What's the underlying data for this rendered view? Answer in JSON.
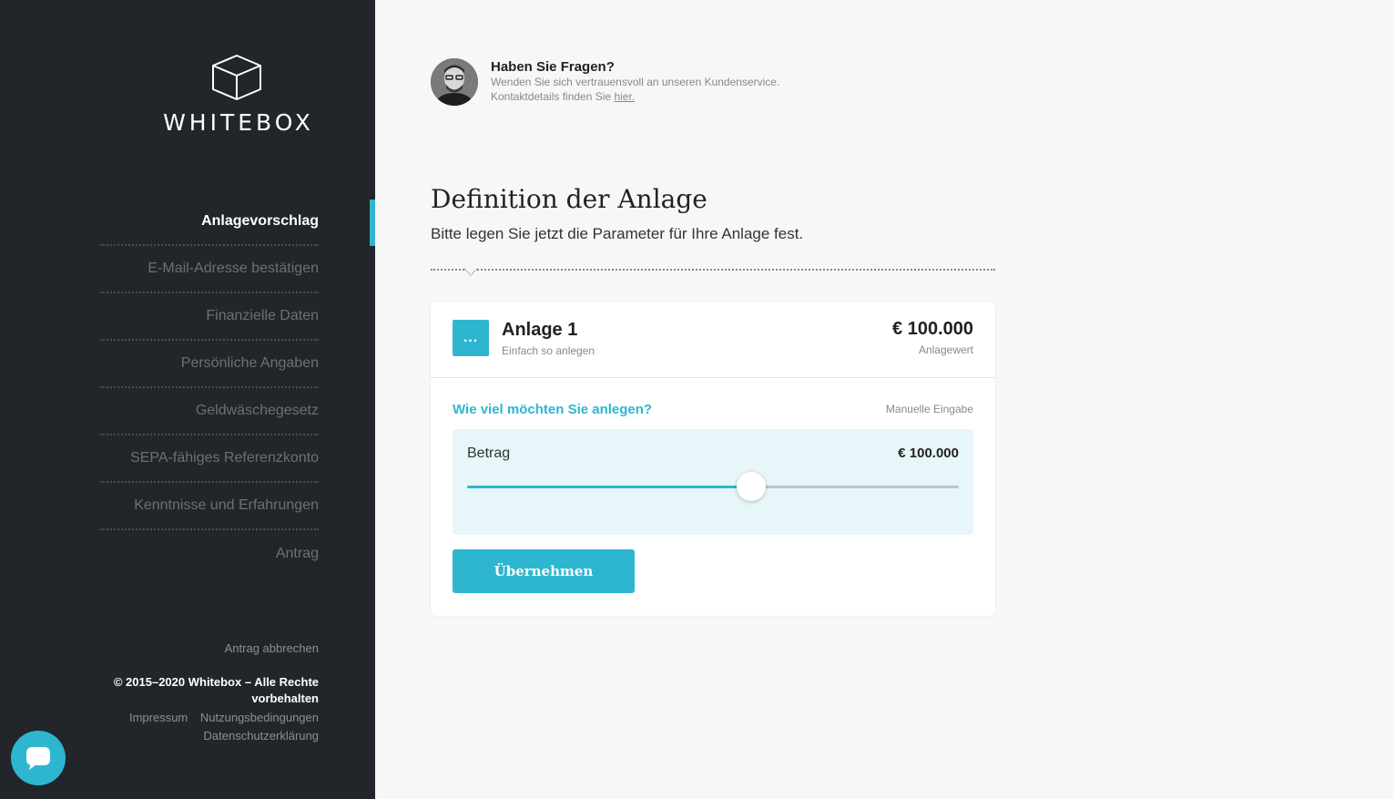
{
  "brand": {
    "name": "WHITEBOX"
  },
  "sidebar": {
    "items": [
      {
        "label": "Anlagevorschlag",
        "active": true
      },
      {
        "label": "E-Mail-Adresse bestätigen",
        "active": false
      },
      {
        "label": "Finanzielle Daten",
        "active": false
      },
      {
        "label": "Persönliche Angaben",
        "active": false
      },
      {
        "label": "Geldwäschegesetz",
        "active": false
      },
      {
        "label": "SEPA-fähiges Referenzkonto",
        "active": false
      },
      {
        "label": "Kenntnisse und Erfahrungen",
        "active": false
      },
      {
        "label": "Antrag",
        "active": false
      }
    ],
    "cancel_label": "Antrag abbrechen",
    "copyright_line1": "© 2015–2020 Whitebox – Alle Rechte",
    "copyright_line2": "vorbehalten",
    "links": {
      "impressum": "Impressum",
      "terms": "Nutzungsbedingungen",
      "privacy": "Datenschutzerklärung"
    }
  },
  "help": {
    "title": "Haben Sie Fragen?",
    "line1": "Wenden Sie sich vertrauensvoll an unseren Kundenservice.",
    "line2_prefix": "Kontaktdetails finden Sie",
    "link": "hier."
  },
  "main": {
    "title": "Definition der Anlage",
    "subtitle": "Bitte legen Sie jetzt die Parameter für Ihre Anlage fest."
  },
  "card": {
    "icon_text": "...",
    "name": "Anlage 1",
    "sub": "Einfach so anlegen",
    "amount": "€ 100.000",
    "amount_label": "Anlagewert",
    "question": "Wie viel möchten Sie anlegen?",
    "manual": "Manuelle Eingabe",
    "slider": {
      "label": "Betrag",
      "value": "€ 100.000",
      "fraction": 0.577
    },
    "button": "Übernehmen"
  },
  "colors": {
    "accent": "#2eb6d1",
    "sidebar": "#22252a",
    "background": "#f7f7f7"
  }
}
